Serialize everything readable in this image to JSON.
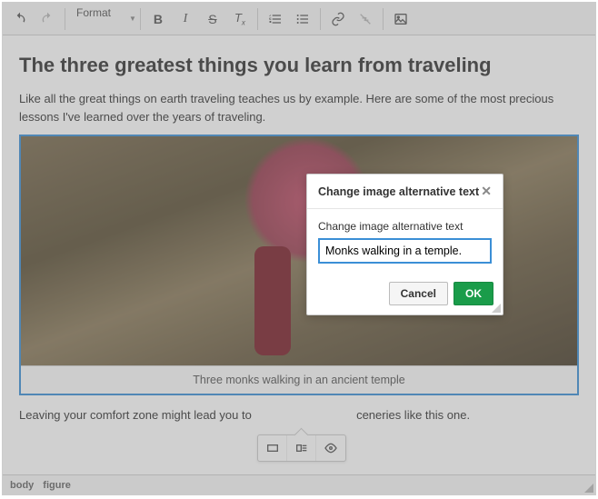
{
  "toolbar": {
    "format_label": "Format"
  },
  "content": {
    "title": "The three greatest things you learn from traveling",
    "para1": "Like all the great things on earth traveling teaches us by example. Here are some of the most precious lessons I've learned over the years of traveling.",
    "caption": "Three monks walking in an ancient temple",
    "para2_before": "Leaving your comfort zone might lead you to ",
    "para2_after": "ceneries like this one."
  },
  "dialog": {
    "title": "Change image alternative text",
    "label": "Change image alternative text",
    "value": "Monks walking in a temple.",
    "cancel": "Cancel",
    "ok": "OK"
  },
  "path": {
    "body": "body",
    "figure": "figure"
  }
}
